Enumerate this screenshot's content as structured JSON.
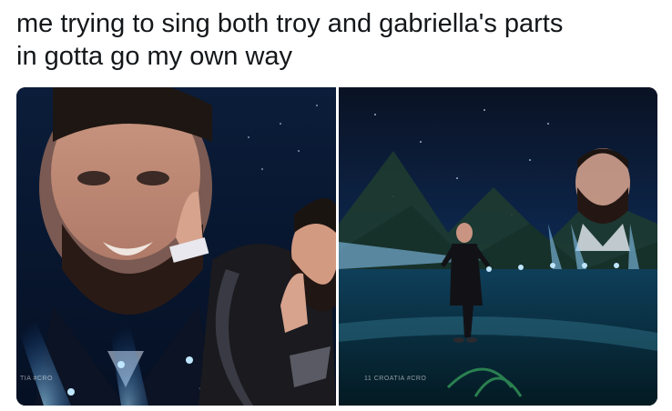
{
  "caption": "me trying to sing both troy and gabriella's parts\nin gotta go my own way",
  "left_photo": {
    "broadcast_tag": "TIA #CRO"
  },
  "right_photo": {
    "broadcast_tag": "11  CROATIA #CRO"
  },
  "colors": {
    "stage_blue": "#1a6fd6",
    "spotlight": "#8fd0ff",
    "background": "#ffffff",
    "text": "#14171a"
  }
}
